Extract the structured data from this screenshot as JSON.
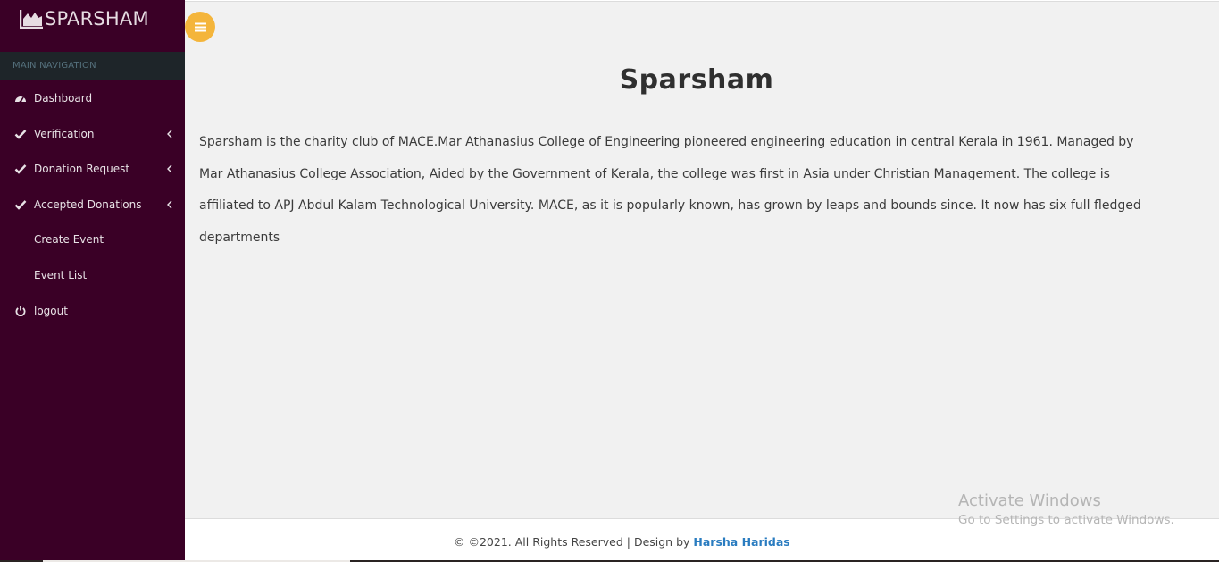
{
  "brand": {
    "name": "SPARSHAM",
    "logo_icon": "chart-logo-icon"
  },
  "sidebar": {
    "header": "MAIN NAVIGATION",
    "items": [
      {
        "label": "Dashboard",
        "icon": "dashboard-icon",
        "has_submenu": false
      },
      {
        "label": "Verification",
        "icon": "check-icon",
        "has_submenu": true
      },
      {
        "label": "Donation Request",
        "icon": "check-icon",
        "has_submenu": true
      },
      {
        "label": "Accepted Donations",
        "icon": "check-icon",
        "has_submenu": true
      },
      {
        "label": "Create Event",
        "icon": "",
        "has_submenu": false
      },
      {
        "label": "Event List",
        "icon": "",
        "has_submenu": false
      },
      {
        "label": "logout",
        "icon": "power-icon",
        "has_submenu": false
      }
    ]
  },
  "toggle": {
    "icon": "menu-icon"
  },
  "main": {
    "title": "Sparsham",
    "paragraph": "Sparsham is the charity club of MACE.Mar Athanasius College of Engineering pioneered engineering education in central Kerala in 1961. Managed by Mar Athanasius College Association, Aided by the Government of Kerala, the college was first in Asia under Christian Management. The college is affiliated to APJ Abdul Kalam Technological University. MACE, as it is popularly known, has grown by leaps and bounds since. It now has six full fledged departments"
  },
  "footer": {
    "text": "© ©2021. All Rights Reserved | Design by ",
    "author": "Harsha Haridas"
  },
  "watermark": {
    "title": "Activate Windows",
    "subtitle": "Go to Settings to activate Windows."
  },
  "colors": {
    "sidebar_bg": "#3a0026",
    "nav_header_bg": "#1e2529",
    "toggle_bg": "#f4b53b",
    "link": "#2a7cc0",
    "content_bg": "#f1f1f1"
  }
}
